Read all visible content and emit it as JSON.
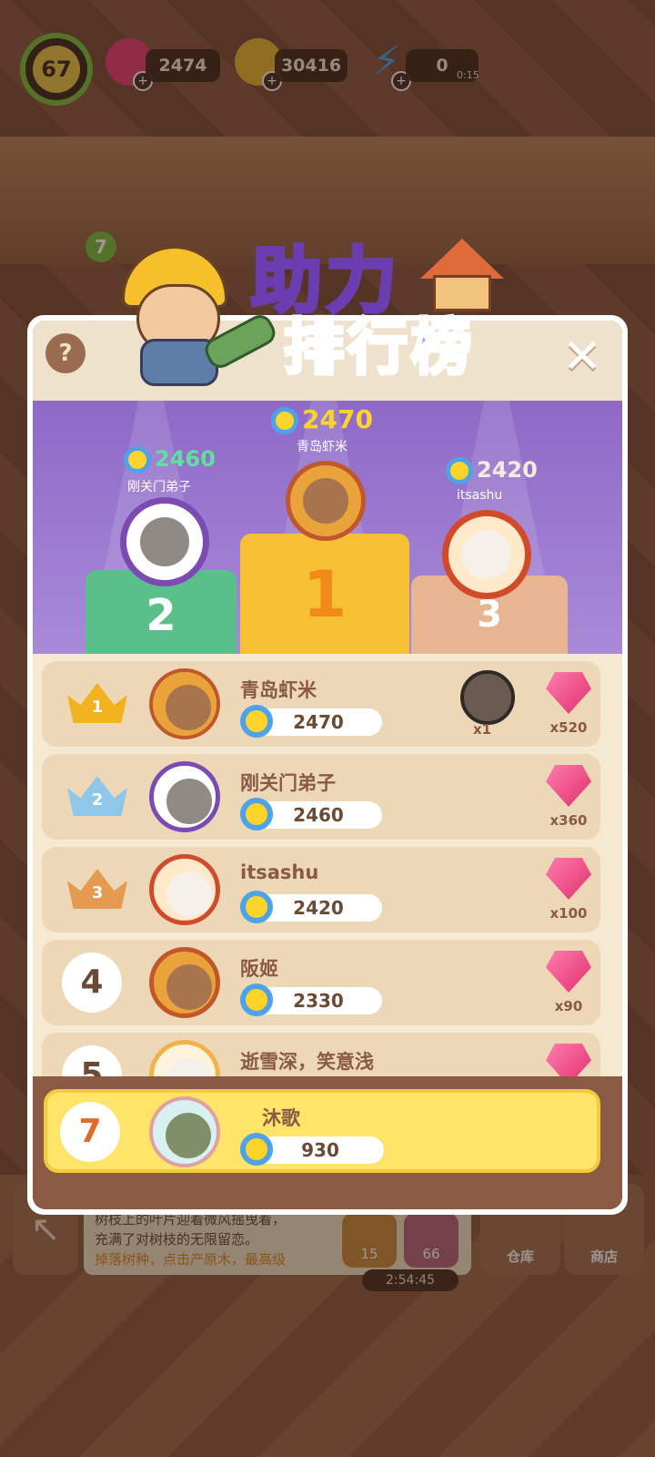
{
  "hud": {
    "level": "67",
    "gems": "2474",
    "coins": "30416",
    "energy": "0",
    "energy_timer": "0:15",
    "level_badge": "7"
  },
  "background": {
    "info_line1": "树枝上的叶片迎着微风摇曳着，",
    "info_line2": "充满了对树枝的无限留恋。",
    "info_hint": "掉落树种，点击产原木，最高级",
    "chip_coins": "15",
    "chip_gems": "66",
    "timer": "2:54:45",
    "warehouse_label": "仓库",
    "shop_label": "商店"
  },
  "modal": {
    "title_line1": "助力",
    "title_line2": "排行榜",
    "help": "?",
    "close": "✕"
  },
  "podium": [
    {
      "place": "1",
      "name": "青岛虾米",
      "score": "2470"
    },
    {
      "place": "2",
      "name": "刚关门弟子",
      "score": "2460"
    },
    {
      "place": "3",
      "name": "itsashu",
      "score": "2420"
    }
  ],
  "rows": [
    {
      "rank": "1",
      "name": "青岛虾米",
      "score": "2470",
      "item_count": "x1",
      "gem_count": "x520"
    },
    {
      "rank": "2",
      "name": "刚关门弟子",
      "score": "2460",
      "gem_count": "x360"
    },
    {
      "rank": "3",
      "name": "itsashu",
      "score": "2420",
      "gem_count": "x100"
    },
    {
      "rank": "4",
      "name": "阪姬",
      "score": "2330",
      "gem_count": "x90"
    },
    {
      "rank": "5",
      "name": "逝雪深，笑意浅",
      "score": "",
      "gem_count": ""
    }
  ],
  "me": {
    "rank": "7",
    "name": "沐歌",
    "score": "930"
  },
  "colors": {
    "gold": "#ffd42a",
    "purple": "#8e69c7",
    "gem_pink": "#e0306a",
    "flower_blue": "#4ea3e8",
    "my_row": "#ffe46a"
  }
}
